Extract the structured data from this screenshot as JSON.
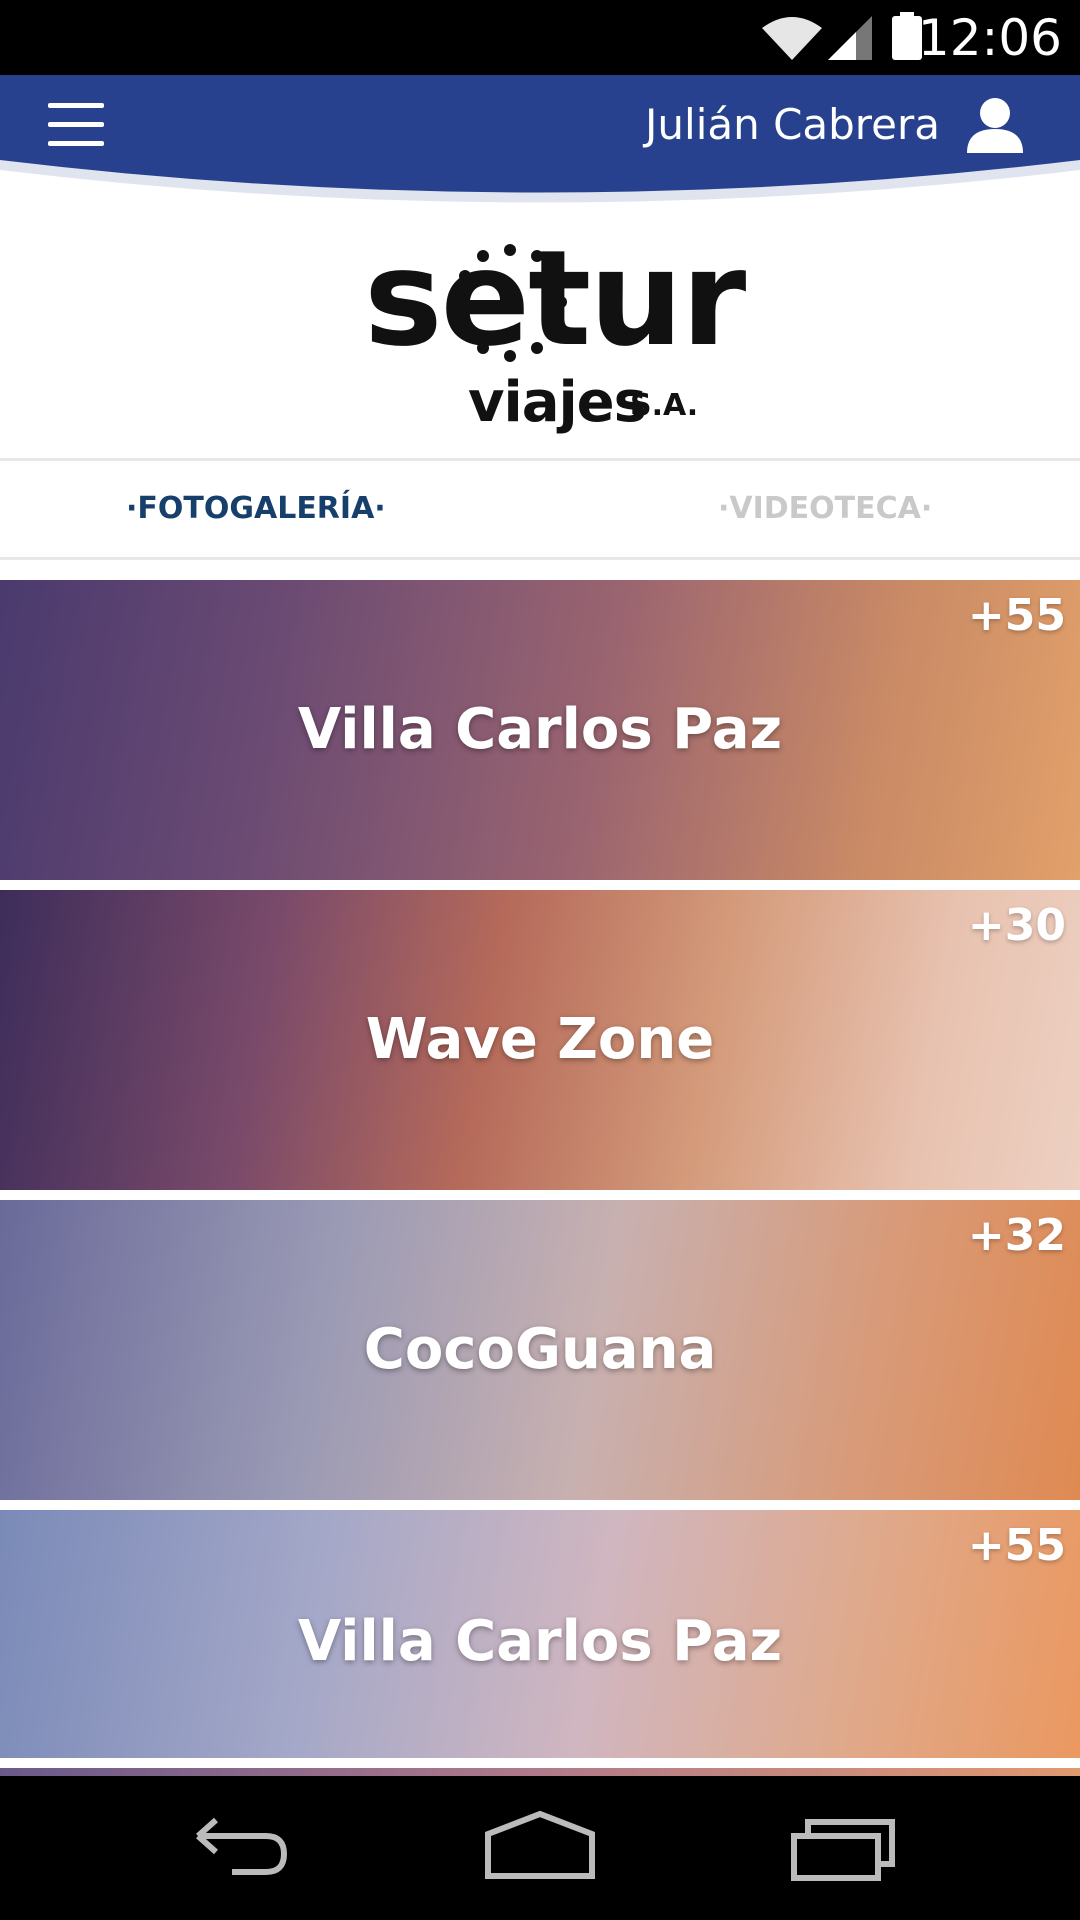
{
  "status_bar": {
    "time": "12:06",
    "icons": [
      "wifi-icon",
      "signal-icon",
      "battery-icon"
    ]
  },
  "header": {
    "menu_icon": "hamburger-menu-icon",
    "user_name": "Julián Cabrera",
    "user_icon": "user-icon",
    "color": "#27418f"
  },
  "logo": {
    "brand": "setur",
    "sub": "viajes",
    "suffix": "S.A."
  },
  "tabs": [
    {
      "label": "·FOTOGALERÍA·",
      "active": true
    },
    {
      "label": "·VIDEOTECA·",
      "active": false
    }
  ],
  "gallery": [
    {
      "title": "Villa Carlos Paz",
      "count": "+55"
    },
    {
      "title": "Wave Zone",
      "count": "+30"
    },
    {
      "title": "CocoGuana",
      "count": "+32"
    },
    {
      "title": "Villa Carlos Paz",
      "count": "+55"
    }
  ],
  "nav": [
    "back-icon",
    "home-icon",
    "recent-apps-icon"
  ]
}
